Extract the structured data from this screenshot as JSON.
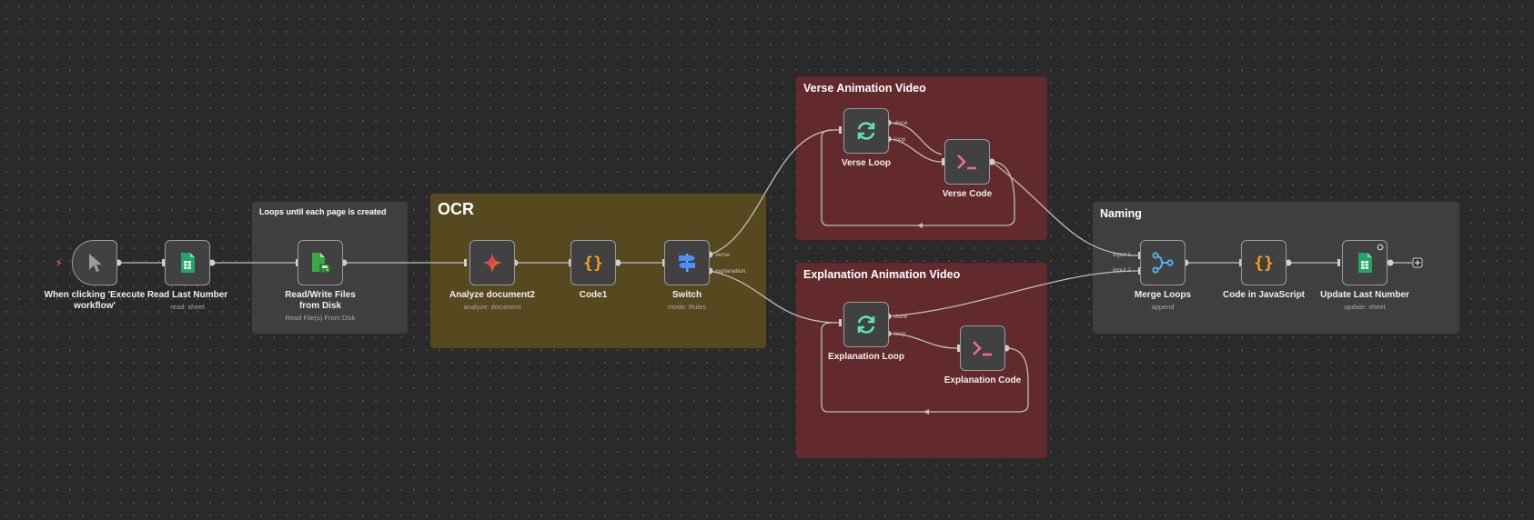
{
  "stickies": {
    "loops": {
      "title": "Loops until each page is created",
      "color": "#3f3f3f"
    },
    "ocr": {
      "title": "OCR",
      "color": "#57491f"
    },
    "verse": {
      "title": "Verse Animation Video",
      "color": "#622a2d"
    },
    "explanation": {
      "title": "Explanation Animation Video",
      "color": "#622a2d"
    },
    "naming": {
      "title": "Naming",
      "color": "#3f3f3f"
    }
  },
  "nodes": {
    "trigger": {
      "label": "When clicking 'Execute workflow'",
      "icon": "cursor-icon"
    },
    "read_last_number": {
      "label": "Read Last Number",
      "subtitle": "read: sheet",
      "icon": "google-sheets-icon"
    },
    "read_write_files": {
      "label": "Read/Write Files from Disk",
      "subtitle": "Read File(s) From Disk",
      "icon": "file-disk-icon"
    },
    "analyze_document": {
      "label": "Analyze document2",
      "subtitle": "analyze: document",
      "icon": "gemini-icon"
    },
    "code1": {
      "label": "Code1",
      "icon": "code-braces-icon"
    },
    "switch": {
      "label": "Switch",
      "subtitle": "mode: Rules",
      "icon": "switch-signpost-icon"
    },
    "verse_loop": {
      "label": "Verse Loop",
      "icon": "loop-icon"
    },
    "verse_code": {
      "label": "Verse Code",
      "icon": "terminal-icon"
    },
    "explanation_loop": {
      "label": "Explanation Loop",
      "icon": "loop-icon"
    },
    "explanation_code": {
      "label": "Explanation Code",
      "icon": "terminal-icon"
    },
    "merge_loops": {
      "label": "Merge Loops",
      "subtitle": "append",
      "icon": "merge-icon"
    },
    "code_in_js": {
      "label": "Code in JavaScript",
      "icon": "code-braces-icon"
    },
    "update_last_number": {
      "label": "Update Last Number",
      "subtitle": "update: sheet",
      "icon": "google-sheets-icon"
    }
  },
  "ports": {
    "switch_out1": "verse",
    "switch_out2": "explanation",
    "verse_done": "done",
    "verse_loop": "loop",
    "explanation_done": "done",
    "explanation_loop": "loop",
    "merge_in1": "Input 1",
    "merge_in2": "Input 2"
  }
}
